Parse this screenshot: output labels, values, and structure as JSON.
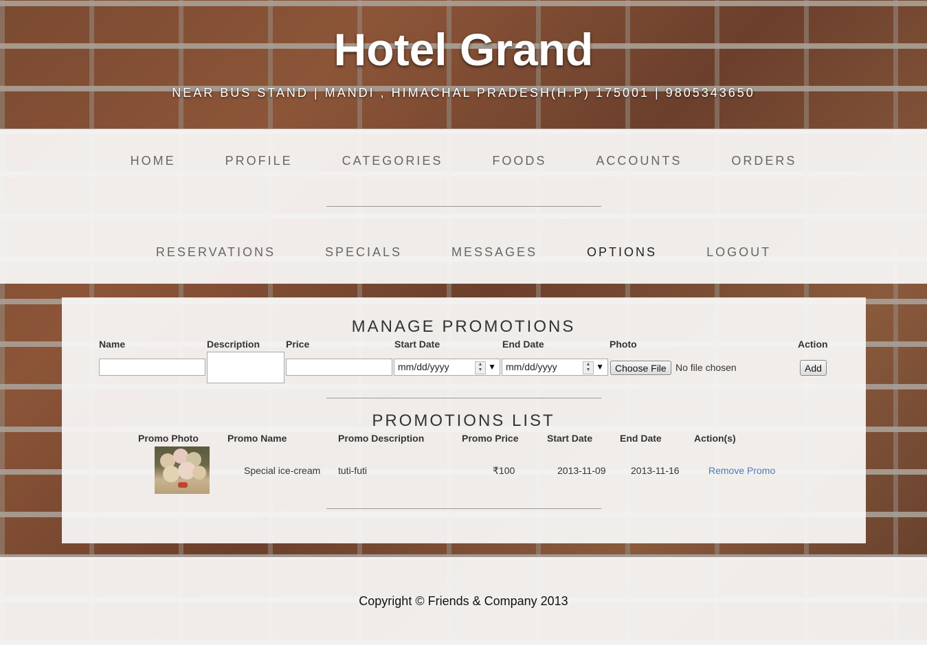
{
  "header": {
    "title": "Hotel Grand",
    "address": "NEAR BUS STAND | MANDI , HIMACHAL PRADESH(H.P) 175001 | 9805343650"
  },
  "nav": {
    "row1": [
      "HOME",
      "PROFILE",
      "CATEGORIES",
      "FOODS",
      "ACCOUNTS",
      "ORDERS"
    ],
    "row2": [
      "RESERVATIONS",
      "SPECIALS",
      "MESSAGES",
      "OPTIONS",
      "LOGOUT"
    ],
    "active": "OPTIONS"
  },
  "manage": {
    "title": "MANAGE PROMOTIONS",
    "labels": {
      "name": "Name",
      "description": "Description",
      "price": "Price",
      "start_date": "Start Date",
      "end_date": "End Date",
      "photo": "Photo",
      "action": "Action"
    },
    "date_placeholder": "mm/dd/yyyy",
    "choose_file_label": "Choose File",
    "no_file_text": "No file chosen",
    "add_label": "Add"
  },
  "list": {
    "title": "PROMOTIONS LIST",
    "columns": [
      "Promo Photo",
      "Promo Name",
      "Promo Description",
      "Promo Price",
      "Start Date",
      "End Date",
      "Action(s)"
    ],
    "rows": [
      {
        "name": "Special ice-cream",
        "description": "tuti-futi",
        "price": "₹100",
        "start_date": "2013-11-09",
        "end_date": "2013-11-16",
        "action": "Remove Promo"
      }
    ]
  },
  "footer": {
    "copyright": "Copyright © Friends & Company 2013"
  }
}
